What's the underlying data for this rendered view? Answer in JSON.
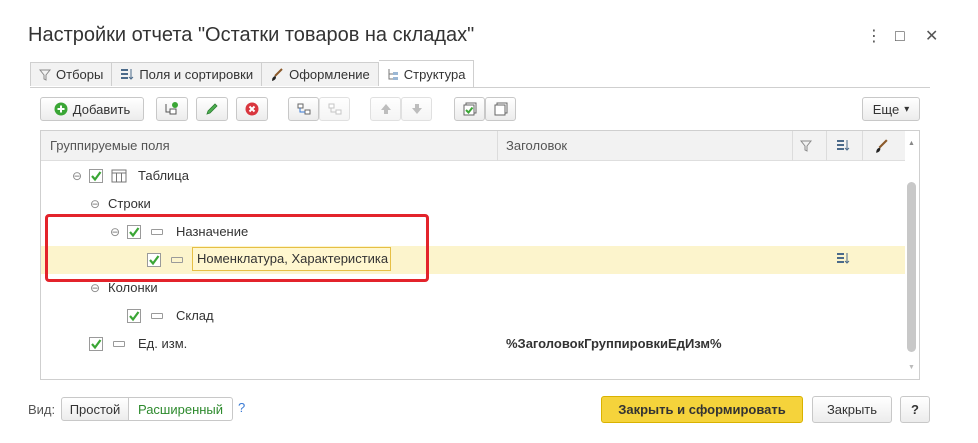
{
  "window": {
    "title": "Настройки отчета \"Остатки товаров на складах\"",
    "more_glyph": "⋮",
    "maximize_glyph": "□",
    "close_glyph": "✕"
  },
  "tabs": [
    {
      "label": "Отборы",
      "icon": "filter-icon",
      "active": false
    },
    {
      "label": "Поля и сортировки",
      "icon": "fields-sort-icon",
      "active": false
    },
    {
      "label": "Оформление",
      "icon": "brush-icon",
      "active": false
    },
    {
      "label": "Структура",
      "icon": "structure-icon",
      "active": true
    }
  ],
  "toolbar": {
    "add_label": "Добавить",
    "more_label": "Еще",
    "more_arrow": "▾"
  },
  "table": {
    "columns": [
      "Группируемые поля",
      "Заголовок"
    ],
    "rows": [
      {
        "label": "Таблица",
        "title": "",
        "checked": true
      },
      {
        "label": "Строки",
        "title": ""
      },
      {
        "label": "Назначение",
        "title": "",
        "checked": true
      },
      {
        "label": "Номенклатура, Характеристика",
        "title": "",
        "checked": true,
        "selected": true
      },
      {
        "label": "Колонки",
        "title": ""
      },
      {
        "label": "Склад",
        "title": "",
        "checked": true
      },
      {
        "label": "Ед. изм.",
        "title": "%ЗаголовокГруппировкиЕдИзм%",
        "checked": true
      }
    ]
  },
  "footer": {
    "view_label": "Вид:",
    "simple_label": "Простой",
    "advanced_label": "Расширенный",
    "help_label": "?",
    "close_and_generate_label": "Закрыть и сформировать",
    "close_label": "Закрыть",
    "question_label": "?"
  },
  "colors": {
    "accent_yellow": "#f5d33b",
    "green": "#3aa635",
    "red": "#d9363e",
    "highlight_red": "#e3232b",
    "selected_row": "#fcf4cc",
    "link_green": "#2d8a2d"
  }
}
